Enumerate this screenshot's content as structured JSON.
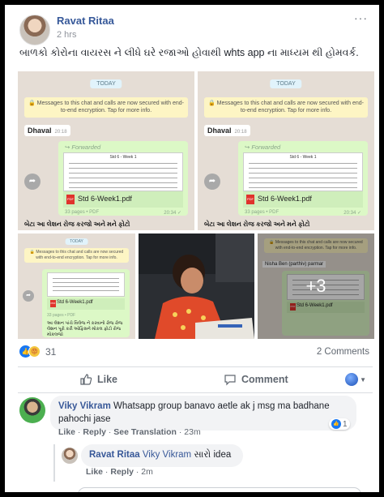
{
  "post": {
    "author": "Ravat Ritaa",
    "time": "2 hrs",
    "more": "···",
    "text": "બાળકો કોરોના વાયરસ ને લીધે ઘરે રજાઓ હોવાથી whts app ના માધ્યમ થી હોમવર્ક."
  },
  "images": {
    "today": "TODAY",
    "encryption": "🔒 Messages to this chat and calls are now secured with end-to-end encryption. Tap for more info.",
    "sender": "Dhaval",
    "sender_time": "20:18",
    "forwarded": "Forwarded",
    "doc_title": "Std 6 - Week 1",
    "pdf_name": "Std 6-Week1.pdf",
    "pdf_meta": "33 pages • PDF",
    "pdf_time": "20:34 ✓",
    "caption": "બેટા આ લેશન રોજ કરજો અને મને ફોટો",
    "caption2_line1": "આ લેશન પાંચે વિલેજ ને કરવાનો રોજ રોજ",
    "caption2_line2": "લેશન પૂરો કરી ઓફિસને મોકલ ફોટો રોજ મોકલજો",
    "third_sender": "Nisha Ben (parthiv) parmar",
    "more_count": "+3"
  },
  "reactions": {
    "count": "31",
    "comments": "2 Comments"
  },
  "actions": {
    "like": "Like",
    "comment": "Comment"
  },
  "comments": [
    {
      "author": "Viky Vikram",
      "text": "Whatsapp group banavo aetle ak j msg ma badhane pahochi jase",
      "like": "Like",
      "reply": "Reply",
      "translate": "See Translation",
      "time": "23m",
      "reaction_count": "1"
    },
    {
      "author": "Ravat Ritaa",
      "mention": "Viky Vikram",
      "text": "સારો idea",
      "like": "Like",
      "reply": "Reply",
      "time": "2m"
    }
  ],
  "colors": {
    "name_blue": "#365899",
    "chat_bg": "#e5ddd5",
    "bubble_green": "#dcf8c6",
    "facebook_blue": "#1877f2"
  }
}
